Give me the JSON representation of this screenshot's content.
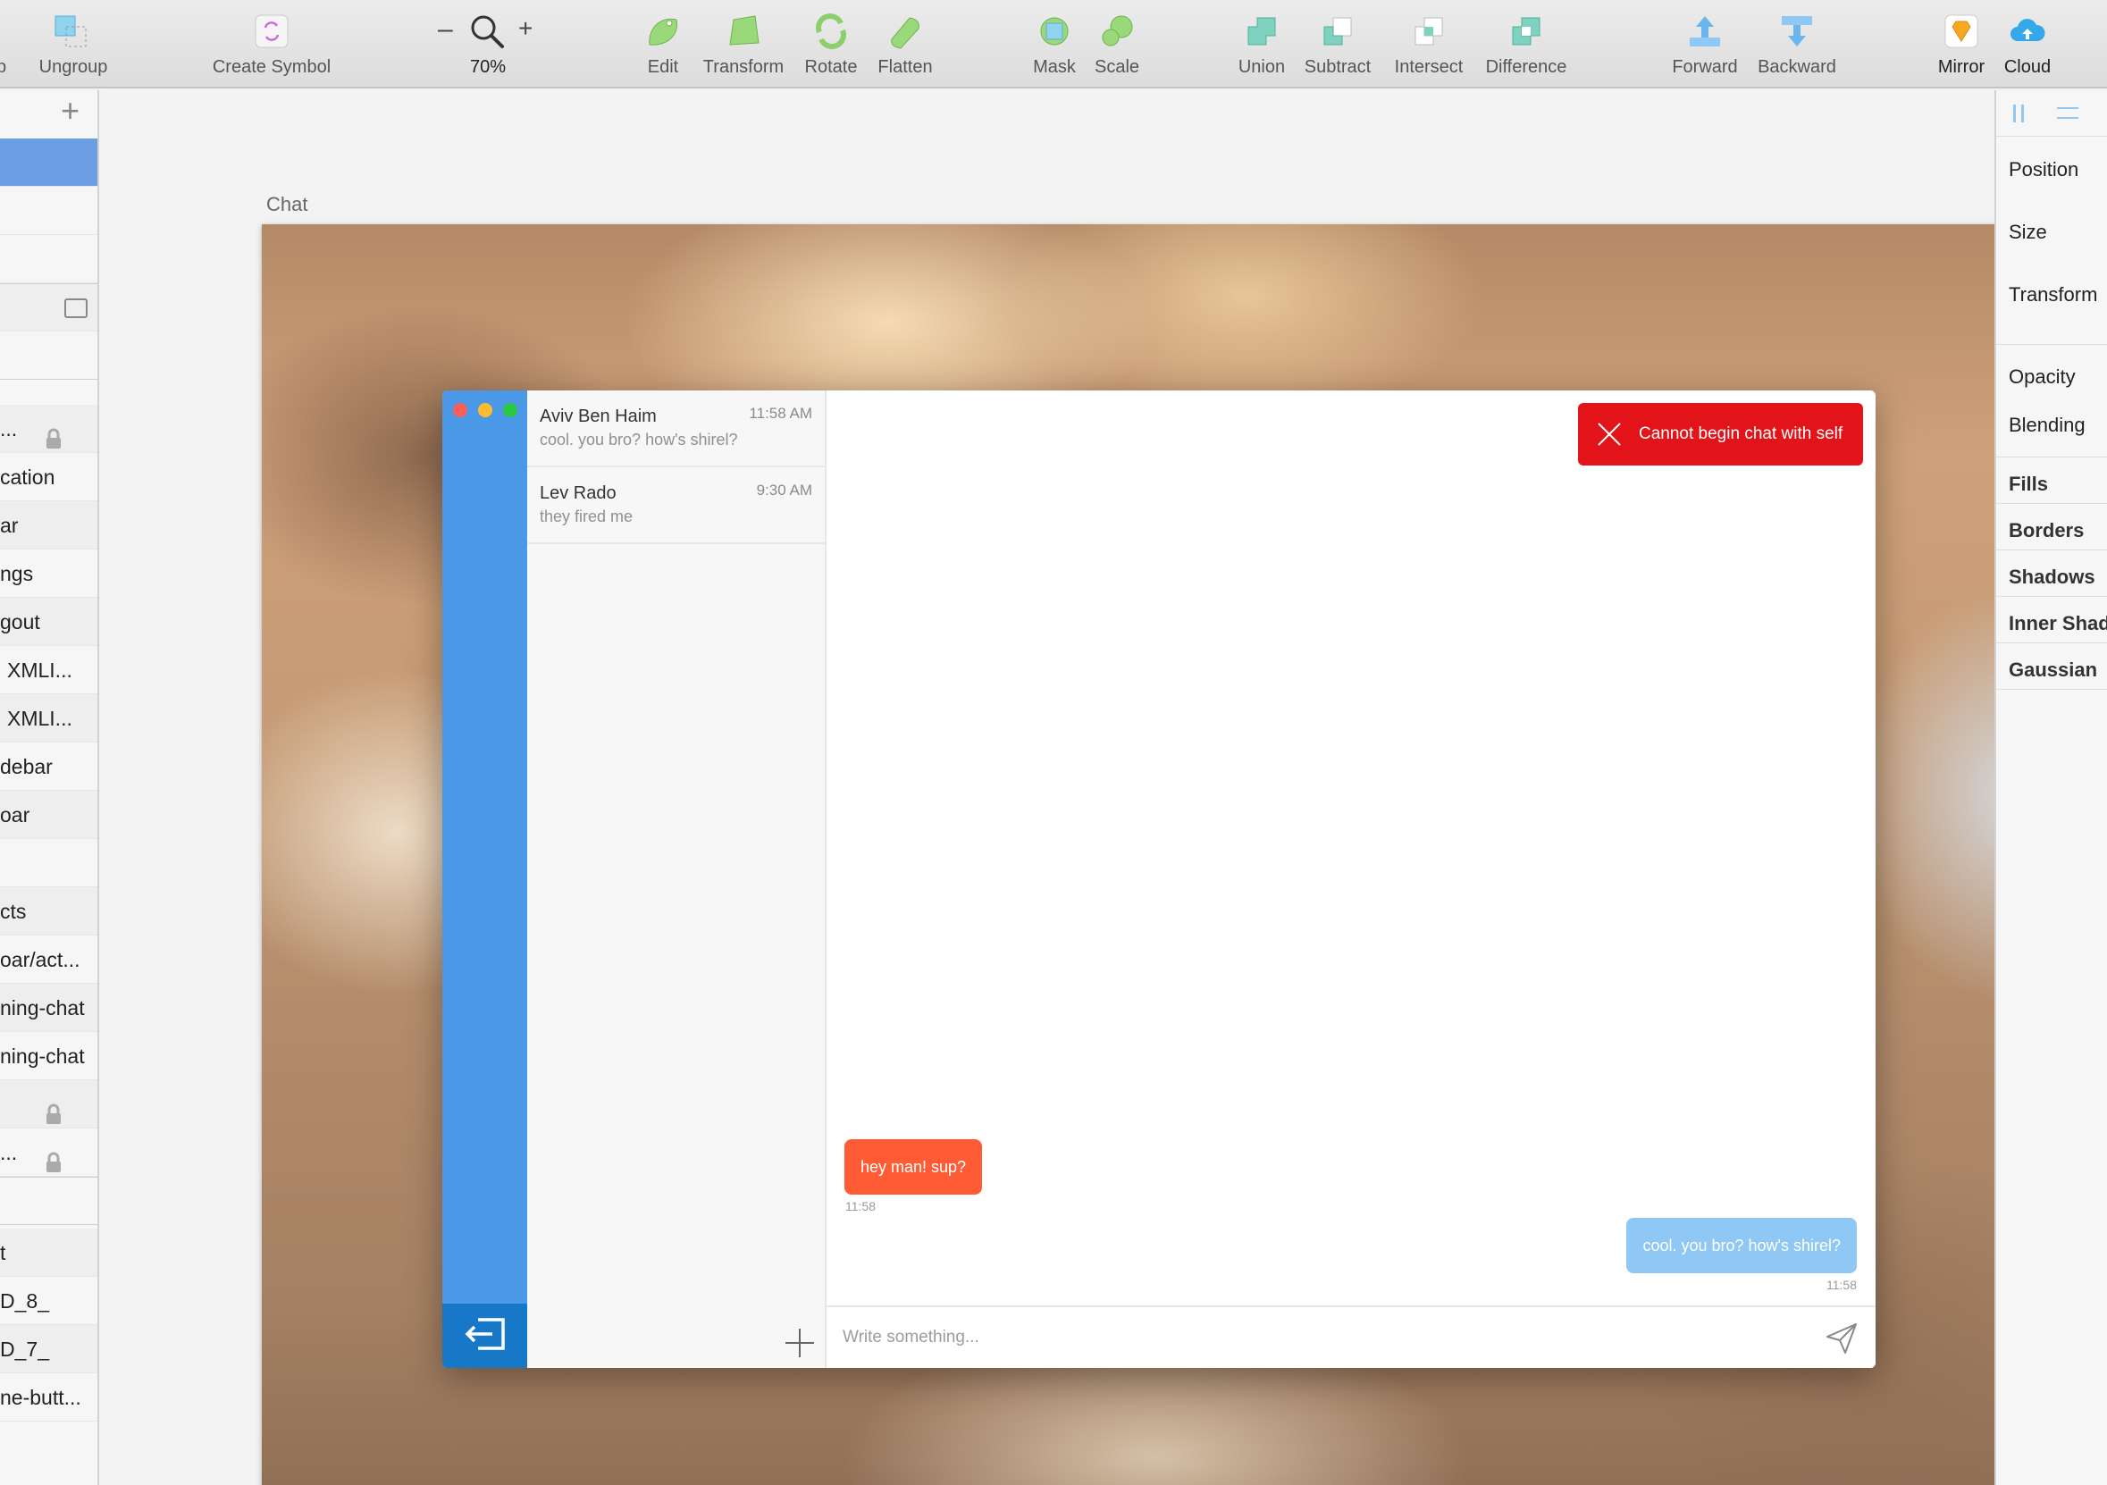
{
  "toolbar": {
    "items": [
      {
        "label": "up",
        "icon": "group-icon"
      },
      {
        "label": "Ungroup",
        "icon": "ungroup-icon"
      },
      {
        "label": "Create Symbol",
        "icon": "create-symbol-icon"
      },
      {
        "label": "70%",
        "icon": "zoom-icon"
      },
      {
        "label": "Edit",
        "icon": "edit-icon"
      },
      {
        "label": "Transform",
        "icon": "transform-icon"
      },
      {
        "label": "Rotate",
        "icon": "rotate-icon"
      },
      {
        "label": "Flatten",
        "icon": "flatten-icon"
      },
      {
        "label": "Mask",
        "icon": "mask-icon"
      },
      {
        "label": "Scale",
        "icon": "scale-icon"
      },
      {
        "label": "Union",
        "icon": "union-icon"
      },
      {
        "label": "Subtract",
        "icon": "subtract-icon"
      },
      {
        "label": "Intersect",
        "icon": "intersect-icon"
      },
      {
        "label": "Difference",
        "icon": "difference-icon"
      },
      {
        "label": "Forward",
        "icon": "forward-icon"
      },
      {
        "label": "Backward",
        "icon": "backward-icon"
      },
      {
        "label": "Mirror",
        "icon": "mirror-icon"
      },
      {
        "label": "Cloud",
        "icon": "cloud-icon"
      }
    ],
    "zoom_minus": "–",
    "zoom_plus": "+"
  },
  "layers": {
    "add_label": "+",
    "rows": [
      {
        "label": "",
        "selected": true
      },
      {
        "label": ""
      },
      {
        "label": ""
      },
      {
        "label": ""
      },
      {
        "label": ""
      },
      {
        "label": "...",
        "locked": true
      },
      {
        "label": "cation"
      },
      {
        "label": "ar"
      },
      {
        "label": "ngs"
      },
      {
        "label": "gout"
      },
      {
        "label": "  XMLI..."
      },
      {
        "label": "  XMLI..."
      },
      {
        "label": "debar"
      },
      {
        "label": "oar"
      },
      {
        "label": ""
      },
      {
        "label": "cts"
      },
      {
        "label": "oar/act..."
      },
      {
        "label": "ning-chat"
      },
      {
        "label": "ning-chat"
      },
      {
        "label": "",
        "locked": true
      },
      {
        "label": "...",
        "locked": true
      },
      {
        "label": ""
      },
      {
        "label": "t"
      },
      {
        "label": "D_8_"
      },
      {
        "label": "D_7_"
      },
      {
        "label": "ne-butt..."
      }
    ]
  },
  "artboard": {
    "name": "Chat"
  },
  "chat": {
    "conversations": [
      {
        "name": "Aviv Ben Haim",
        "time": "11:58 AM",
        "preview": "cool. you bro? how's shirel?"
      },
      {
        "name": "Lev Rado",
        "time": "9:30 AM",
        "preview": "they fired me"
      }
    ],
    "toast": "Cannot begin chat with self",
    "messages": [
      {
        "text": "hey man! sup?",
        "time": "11:58",
        "direction": "incoming"
      },
      {
        "text": "cool. you bro? how's shirel?",
        "time": "11:58",
        "direction": "outgoing"
      }
    ],
    "composer_placeholder": "Write something...",
    "colors": {
      "sidebar": "#4b98e6",
      "logout": "#1878c8",
      "incoming": "#ff5b35",
      "outgoing": "#8fc7f5",
      "toast": "#e2141a"
    }
  },
  "inspector": {
    "rows": [
      "Position",
      "Size",
      "Transform",
      "Opacity",
      "Blending"
    ],
    "sections": [
      "Fills",
      "Borders",
      "Shadows",
      "Inner Shad",
      "Gaussian"
    ]
  }
}
